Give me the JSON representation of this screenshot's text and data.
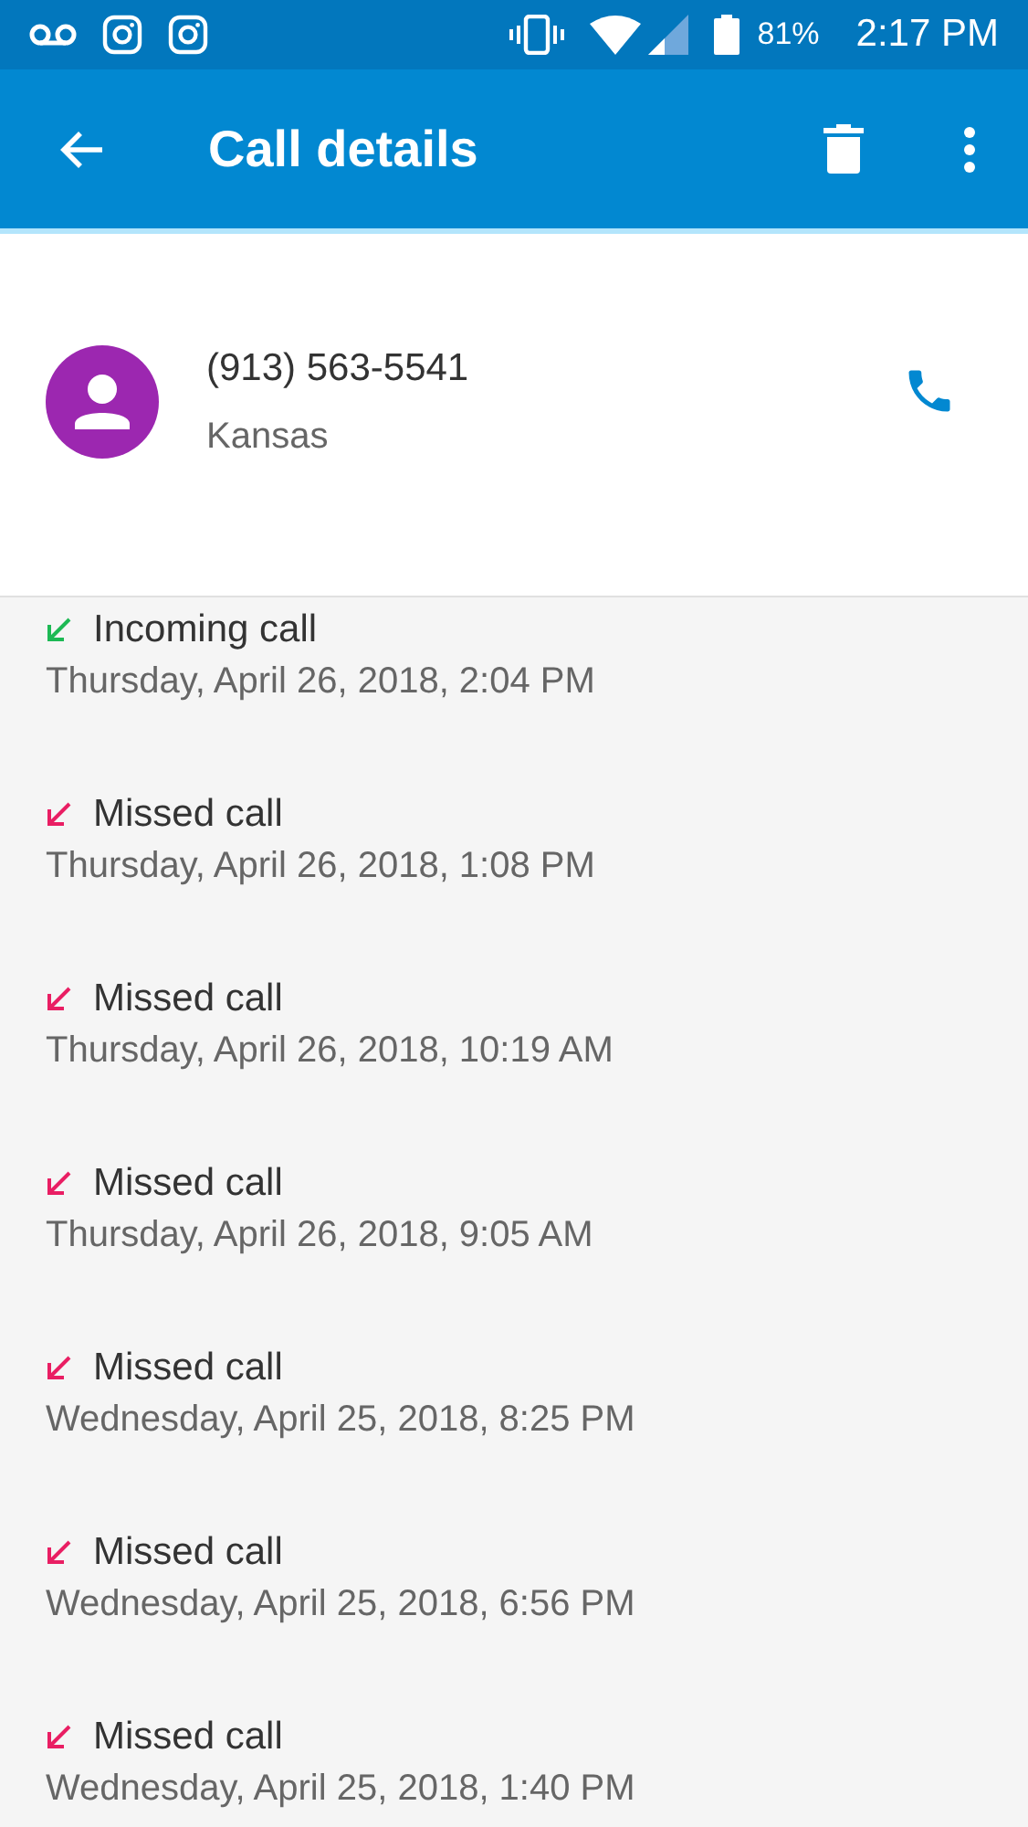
{
  "status_bar": {
    "battery": "81%",
    "time": "2:17 PM"
  },
  "app_bar": {
    "title": "Call details"
  },
  "contact": {
    "number": "(913) 563-5541",
    "location": "Kansas"
  },
  "calls": [
    {
      "kind": "incoming",
      "label": "Incoming call",
      "time": "Thursday, April 26, 2018, 2:04 PM"
    },
    {
      "kind": "missed",
      "label": "Missed call",
      "time": "Thursday, April 26, 2018, 1:08 PM"
    },
    {
      "kind": "missed",
      "label": "Missed call",
      "time": "Thursday, April 26, 2018, 10:19 AM"
    },
    {
      "kind": "missed",
      "label": "Missed call",
      "time": "Thursday, April 26, 2018, 9:05 AM"
    },
    {
      "kind": "missed",
      "label": "Missed call",
      "time": "Wednesday, April 25, 2018, 8:25 PM"
    },
    {
      "kind": "missed",
      "label": "Missed call",
      "time": "Wednesday, April 25, 2018, 6:56 PM"
    },
    {
      "kind": "missed",
      "label": "Missed call",
      "time": "Wednesday, April 25, 2018, 1:40 PM"
    }
  ]
}
